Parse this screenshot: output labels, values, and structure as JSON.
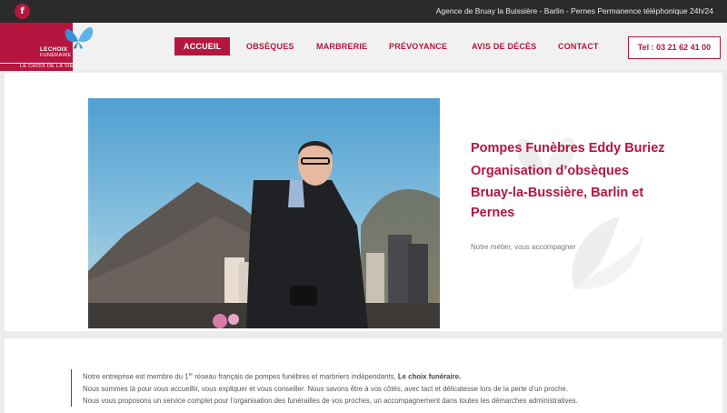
{
  "topbar": {
    "facebook_glyph": "f",
    "info": "Agence de Bruay la Buissière - Barlin - Pernes Permanence téléphonique 24h/24"
  },
  "logo": {
    "wordmark_1": "LECHOIX",
    "wordmark_2": "FUNÉRAIRE",
    "tagline": "LE CHOIX DE LA VIE"
  },
  "nav": {
    "items": [
      {
        "label": "ACCUEIL",
        "active": true
      },
      {
        "label": "OBSÈQUES",
        "active": false
      },
      {
        "label": "MARBRERIE",
        "active": false
      },
      {
        "label": "PRÉVOYANCE",
        "active": false
      },
      {
        "label": "AVIS DE DÉCÈS",
        "active": false
      },
      {
        "label": "CONTACT",
        "active": false
      }
    ],
    "phone_button": "Tel : 03 21 62 41 00"
  },
  "hero": {
    "title_1": "Pompes Funèbres Eddy Buriez",
    "title_2": "Organisation d’obsèques",
    "title_3": "Bruay-la-Bussière, Barlin et Pernes",
    "subtitle": "Notre métier, vous accompagner"
  },
  "intro": {
    "line1_pre": "Notre entreprise est membre du 1",
    "line1_sup": "er",
    "line1_post": " réseau français de pompes funèbres et marbriers indépendants, ",
    "line1_bold": "Le choix funéraire.",
    "line2": "Nous sommes là pour vous accueillir, vous expliquer et vous conseiller. Nous savons être à vos côtés, avec tact et délicatesse lors de la perte d’un proche. Nous vous proposons un service complet pour l’organisation des funérailles de vos proches, un accompagnement dans toutes les démarches administratives."
  },
  "colors": {
    "brand": "#b5163f",
    "topbar": "#2b2b2b"
  }
}
